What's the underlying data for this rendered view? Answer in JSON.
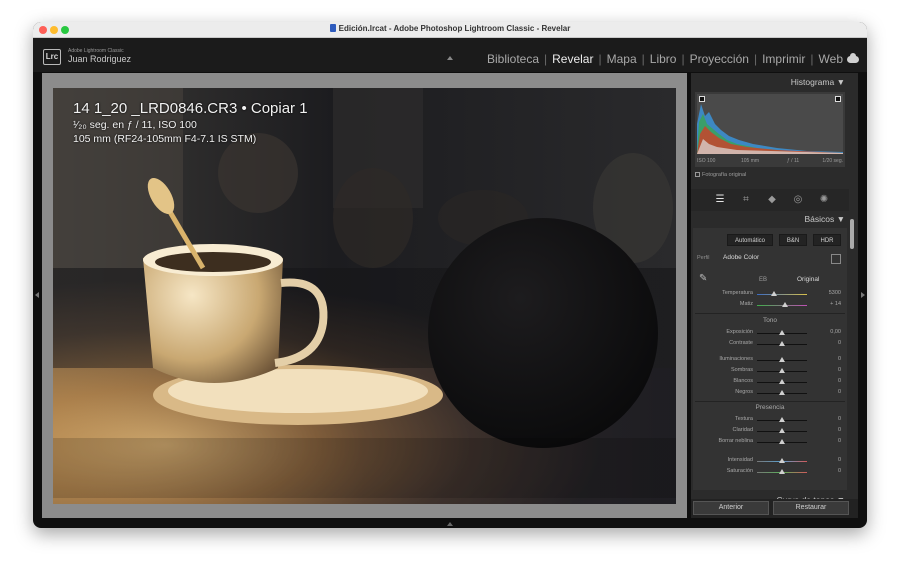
{
  "window": {
    "title": "Edición.lrcat - Adobe Photoshop Lightroom Classic - Revelar"
  },
  "identity": {
    "brand": "Adobe Lightroom Classic",
    "user": "Juan Rodriguez",
    "logo": "Lrc"
  },
  "modules": [
    {
      "label": "Biblioteca",
      "active": false
    },
    {
      "label": "Revelar",
      "active": true
    },
    {
      "label": "Mapa",
      "active": false
    },
    {
      "label": "Libro",
      "active": false
    },
    {
      "label": "Proyección",
      "active": false
    },
    {
      "label": "Imprimir",
      "active": false
    },
    {
      "label": "Web",
      "active": false
    }
  ],
  "photo_info": {
    "title": "14 1_20 _LRD0846.CR3  •  Copiar 1",
    "exposure": "¹⁄₂₀ seg. en ƒ / 11, ISO 100",
    "lens": "105 mm (RF24-105mm F4-7.1 IS STM)"
  },
  "histogram": {
    "header": "Histograma",
    "iso": "ISO 100",
    "focal": "105 mm",
    "aperture": "ƒ / 11",
    "shutter": "1/20 seg.",
    "original_label": "Fotografía original"
  },
  "basic": {
    "header": "Básicos",
    "buttons": [
      "Automático",
      "B&N",
      "HDR"
    ],
    "profile_label": "Perfil",
    "profile_value": "Adobe Color",
    "wb_label": "EB",
    "wb_value": "Original",
    "sliders": {
      "temperatura": {
        "label": "Temperatura",
        "value": "5300",
        "pos": 0.34
      },
      "matiz": {
        "label": "Matiz",
        "value": "+ 14",
        "pos": 0.55
      },
      "exposicion": {
        "label": "Exposición",
        "value": "0,00",
        "pos": 0.5
      },
      "contraste": {
        "label": "Contraste",
        "value": "0",
        "pos": 0.5
      },
      "iluminaciones": {
        "label": "Iluminaciones",
        "value": "0",
        "pos": 0.5
      },
      "sombras": {
        "label": "Sombras",
        "value": "0",
        "pos": 0.5
      },
      "blancos": {
        "label": "Blancos",
        "value": "0",
        "pos": 0.5
      },
      "negros": {
        "label": "Negros",
        "value": "0",
        "pos": 0.5
      },
      "textura": {
        "label": "Textura",
        "value": "0",
        "pos": 0.5
      },
      "claridad": {
        "label": "Claridad",
        "value": "0",
        "pos": 0.5
      },
      "neblina": {
        "label": "Borrar neblina",
        "value": "0",
        "pos": 0.5
      },
      "intensidad": {
        "label": "Intensidad",
        "value": "0",
        "pos": 0.5
      },
      "saturacion": {
        "label": "Saturación",
        "value": "0",
        "pos": 0.5
      }
    },
    "tono": "Tono",
    "presencia": "Presencia"
  },
  "curve_header": "Curva de tonos",
  "footer": {
    "prev": "Anterior",
    "reset": "Restaurar"
  }
}
